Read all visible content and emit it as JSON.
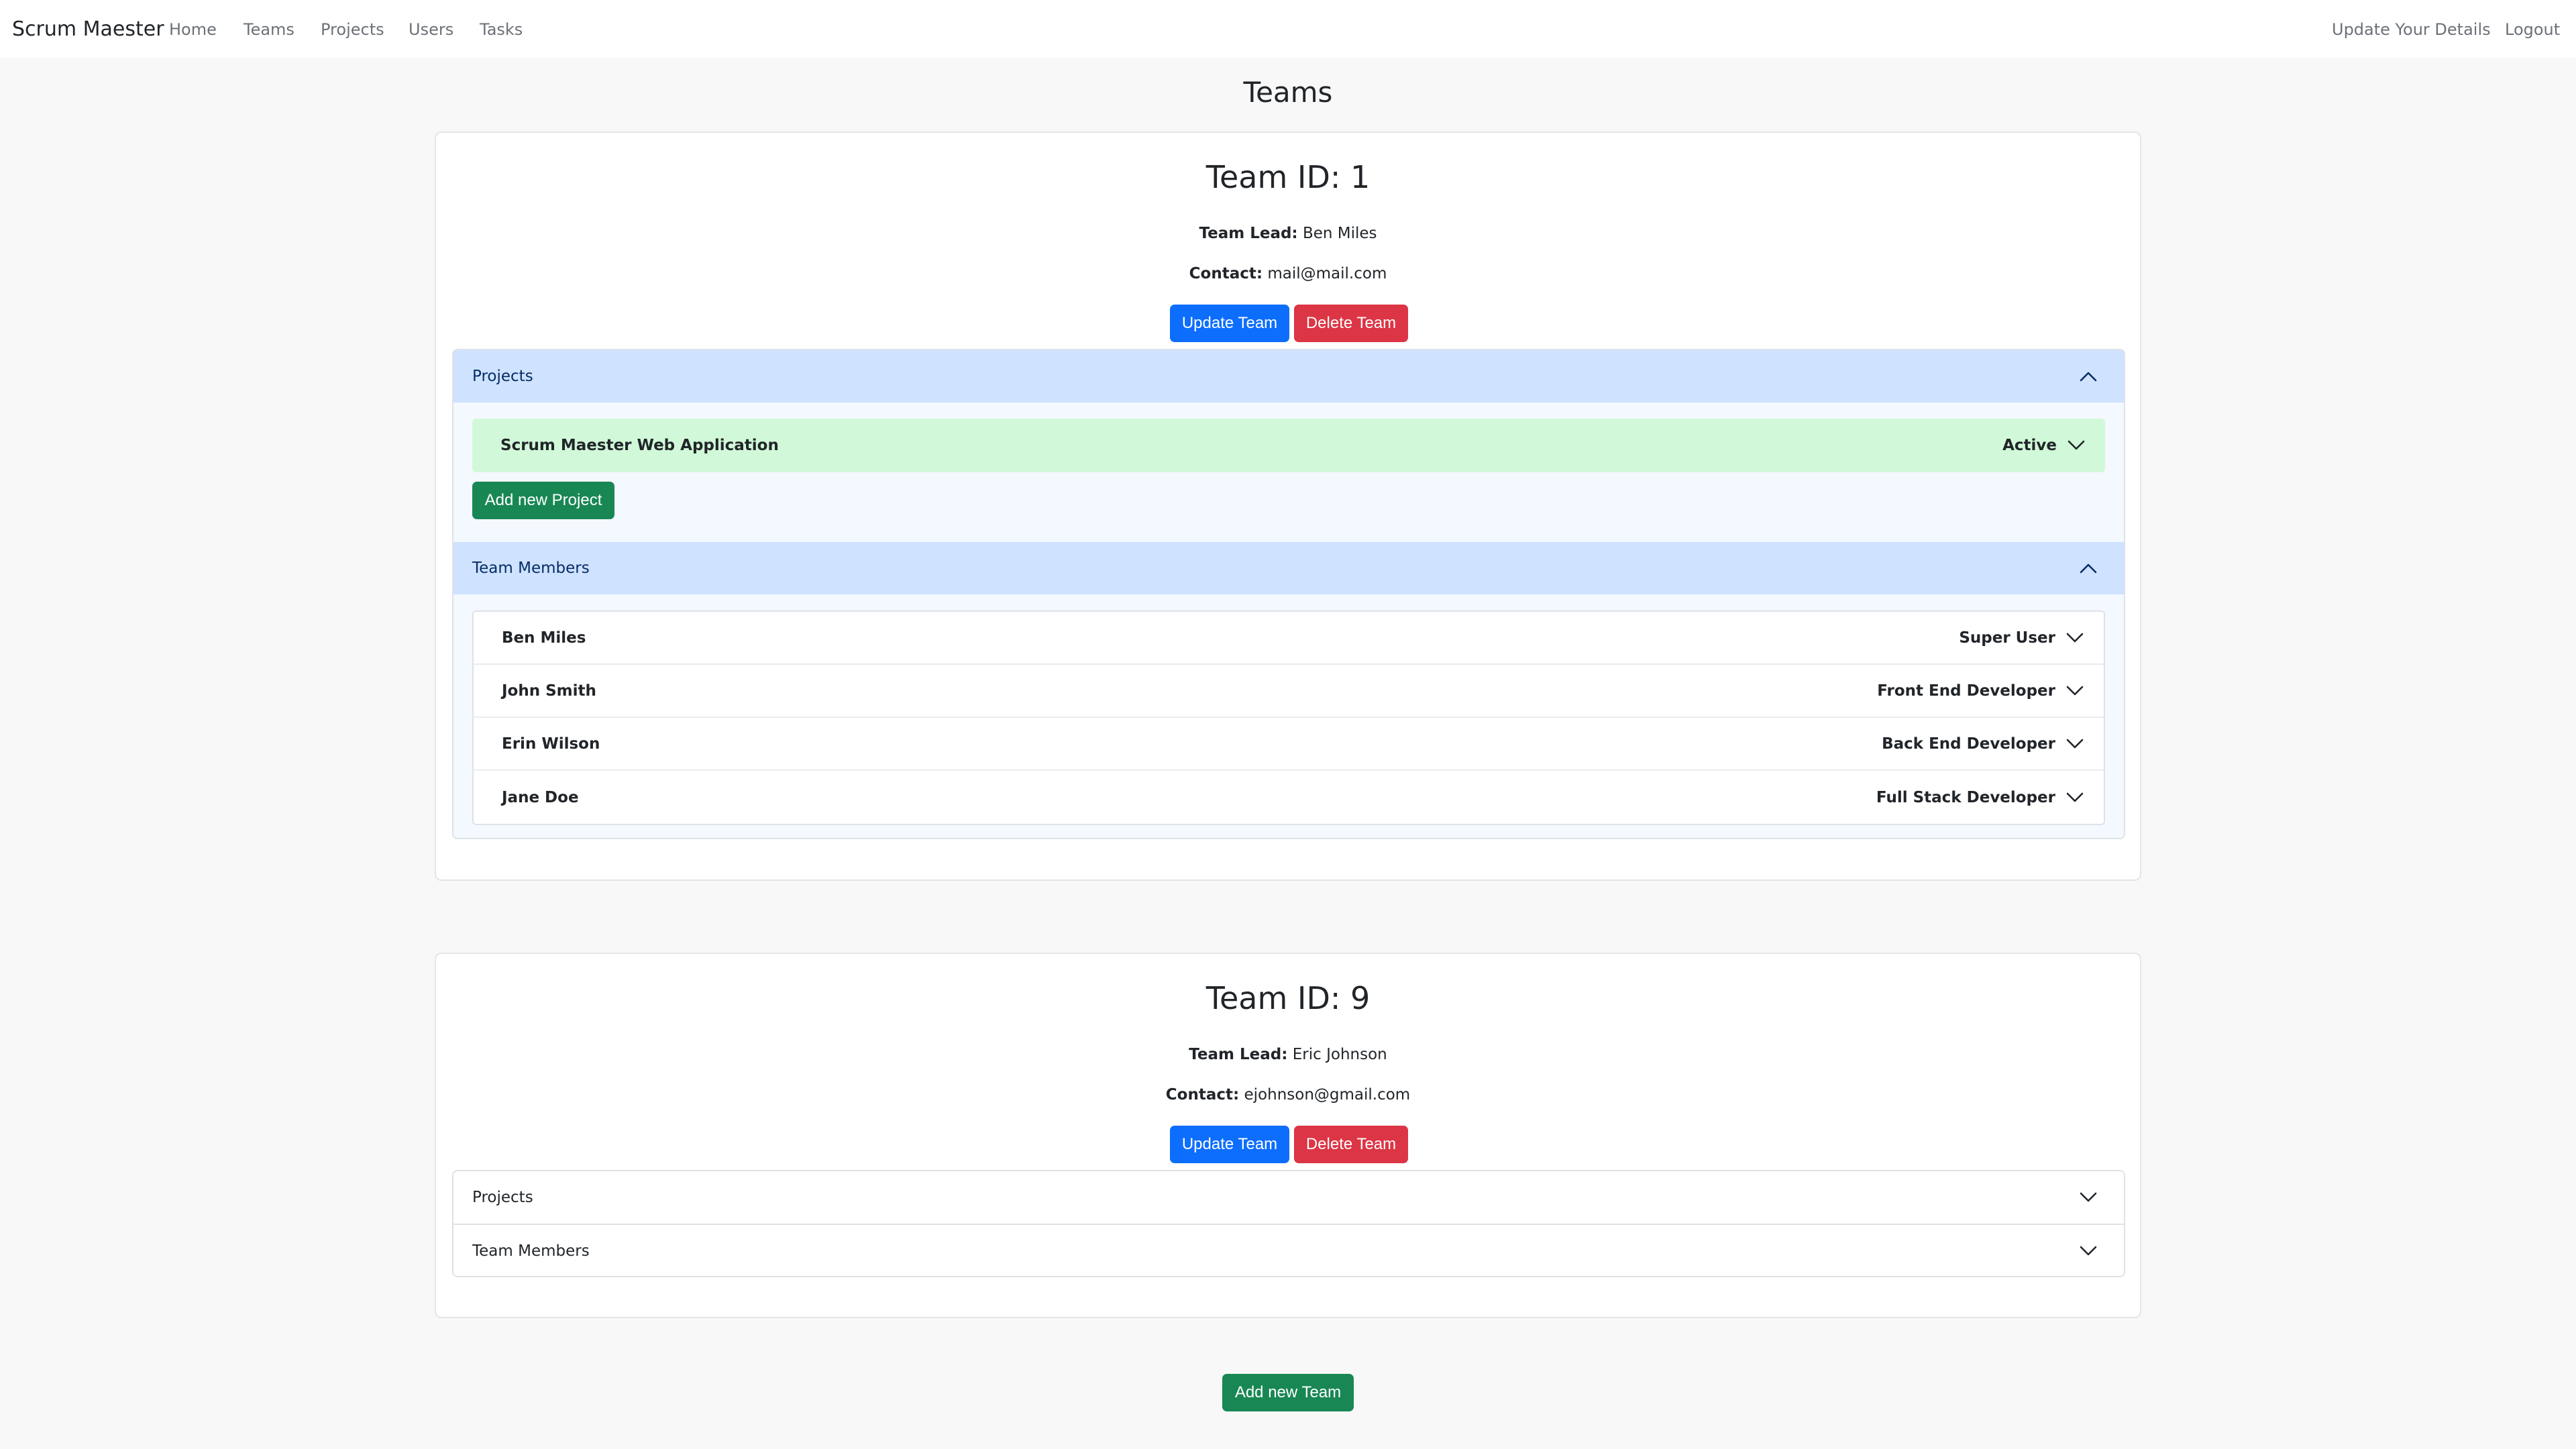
{
  "nav": {
    "brand": "Scrum Maester",
    "links": [
      "Home",
      "Teams",
      "Projects",
      "Users",
      "Tasks"
    ],
    "update_details": "Update Your Details",
    "logout": "Logout"
  },
  "page": {
    "title": "Teams"
  },
  "teams": [
    {
      "title": "Team ID: 1",
      "lead_label": "Team Lead:",
      "lead": "Ben Miles",
      "contact_label": "Contact:",
      "contact": "mail@mail.com",
      "update_label": "Update Team",
      "delete_label": "Delete Team",
      "projects_label": "Projects",
      "members_label": "Team Members",
      "projects": [
        {
          "name": "Scrum Maester Web Application",
          "status": "Active"
        }
      ],
      "add_project_label": "Add new Project",
      "members": [
        {
          "name": "Ben Miles",
          "role": "Super User"
        },
        {
          "name": "John Smith",
          "role": "Front End Developer"
        },
        {
          "name": "Erin Wilson",
          "role": "Back End Developer"
        },
        {
          "name": "Jane Doe",
          "role": "Full Stack Developer"
        }
      ]
    },
    {
      "title": "Team ID: 9",
      "lead_label": "Team Lead:",
      "lead": "Eric Johnson",
      "contact_label": "Contact:",
      "contact": "ejohnson@gmail.com",
      "update_label": "Update Team",
      "delete_label": "Delete Team",
      "projects_label": "Projects",
      "members_label": "Team Members"
    }
  ],
  "add_team_label": "Add new Team",
  "colors": {
    "primary": "#0d6efd",
    "danger": "#dc3545",
    "success": "#198754",
    "accordion_open": "#cfe2ff",
    "project_active": "#d1f9d9"
  }
}
